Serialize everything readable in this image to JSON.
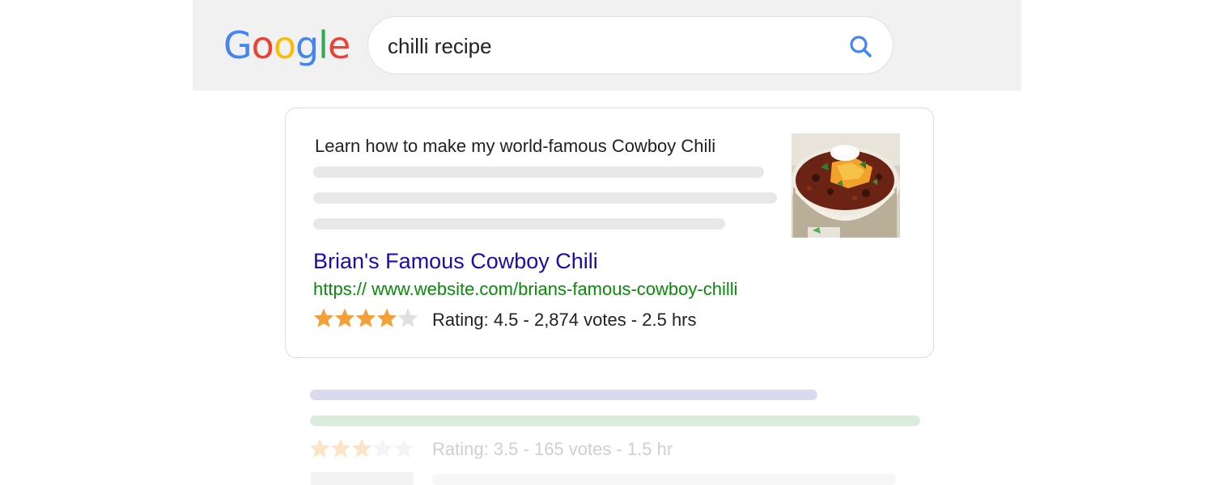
{
  "header": {
    "logo_letters": [
      {
        "char": "G",
        "color": "#4285F4"
      },
      {
        "char": "o",
        "color": "#EA4335"
      },
      {
        "char": "o",
        "color": "#FBBC05"
      },
      {
        "char": "g",
        "color": "#4285F4"
      },
      {
        "char": "l",
        "color": "#34A853"
      },
      {
        "char": "e",
        "color": "#EA4335"
      }
    ],
    "search": {
      "value": "chilli recipe",
      "icon": "search-icon",
      "icon_color": "#4285F4"
    }
  },
  "featured_result": {
    "snippet": "Learn how to make my world-famous Cowboy Chili",
    "thumbnail": "chili-bowl-image",
    "title": "Brian's Famous Cowboy Chili",
    "url": "https:// www.website.com/brians-famous-cowboy-chilli",
    "rating": 4.5,
    "rating_max": 5,
    "rating_text": "Rating: 4.5 - 2,874 votes - 2.5 hrs",
    "star_color": "#F4A03A"
  },
  "second_result": {
    "rating": 3.5,
    "rating_text": "Rating: 3.5 - 165 votes - 1.5 hr"
  },
  "colors": {
    "title_link": "#1a0dab",
    "url": "#0a8a0a"
  }
}
